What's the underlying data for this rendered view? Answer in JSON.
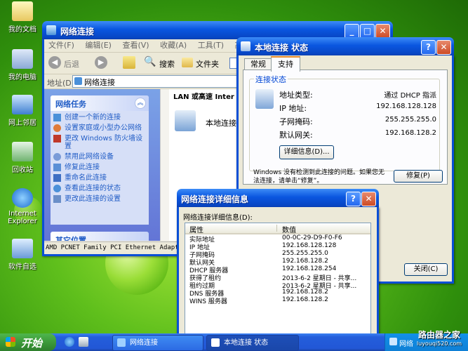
{
  "desktop": {
    "icons": [
      {
        "label": "我的文档",
        "icon": "my-documents-icon"
      },
      {
        "label": "我的电脑",
        "icon": "my-computer-icon"
      },
      {
        "label": "网上邻居",
        "icon": "network-places-icon"
      },
      {
        "label": "回收站",
        "icon": "recycle-bin-icon"
      },
      {
        "label": "Internet Explorer",
        "icon": "ie-icon"
      },
      {
        "label": "软件自选",
        "icon": "software-icon"
      }
    ]
  },
  "explorer": {
    "title": "网络连接",
    "menu": [
      "文件(F)",
      "编辑(E)",
      "查看(V)",
      "收藏(A)",
      "工具(T)",
      "高级"
    ],
    "toolbar": {
      "back": "后退",
      "search": "搜索",
      "folders": "文件夹"
    },
    "address_label": "地址(D)",
    "address_value": "网络连接",
    "network_tasks": {
      "title": "网络任务",
      "items": [
        "创建一个新的连接",
        "设置家庭或小型办公网络",
        "更改 Windows 防火墙设置",
        "禁用此网络设备",
        "修复此连接",
        "重命名此连接",
        "查看此连接的状态",
        "更改此连接的设置"
      ]
    },
    "other_places_title": "其它位置",
    "group_header": "LAN 或高速 Inter",
    "connection_name": "本地连接",
    "status_bar": "AMD PCNET Family PCI Ethernet Adapter"
  },
  "status_dialog": {
    "title": "本地连接 状态",
    "tabs": [
      "常规",
      "支持"
    ],
    "group_title": "连接状态",
    "rows": [
      {
        "label": "地址类型:",
        "value": "通过 DHCP 指派"
      },
      {
        "label": "IP 地址:",
        "value": "192.168.128.128"
      },
      {
        "label": "子网掩码:",
        "value": "255.255.255.0"
      },
      {
        "label": "默认网关:",
        "value": "192.168.128.2"
      }
    ],
    "details_button": "详细信息(D)...",
    "message": "Windows 没有检测到此连接的问题。如果您无法连接，请单击“修复”。",
    "repair_button": "修复(P)",
    "close_button": "关闭(C)"
  },
  "details_dialog": {
    "title": "网络连接详细信息",
    "caption": "网络连接详细信息(D):",
    "columns": [
      "属性",
      "数值"
    ],
    "rows": [
      [
        "实际地址",
        "00-0C-29-D9-F0-F6"
      ],
      [
        "IP 地址",
        "192.168.128.128"
      ],
      [
        "子网掩码",
        "255.255.255.0"
      ],
      [
        "默认网关",
        "192.168.128.2"
      ],
      [
        "DHCP 服务器",
        "192.168.128.254"
      ],
      [
        "获得了租约",
        "2013-6-2 星期日 - 共享..."
      ],
      [
        "租约过期",
        "2013-6-2 星期日 - 共享..."
      ],
      [
        "DNS 服务器",
        "192.168.128.2"
      ],
      [
        "WINS 服务器",
        "192.168.128.2"
      ]
    ]
  },
  "taskbar": {
    "start_label": "开始",
    "tasks": [
      "网络连接",
      "本地连接 状态"
    ],
    "tray_text": "网络",
    "watermark": "路由器之家",
    "watermark_url": "luyouqi520.com"
  }
}
